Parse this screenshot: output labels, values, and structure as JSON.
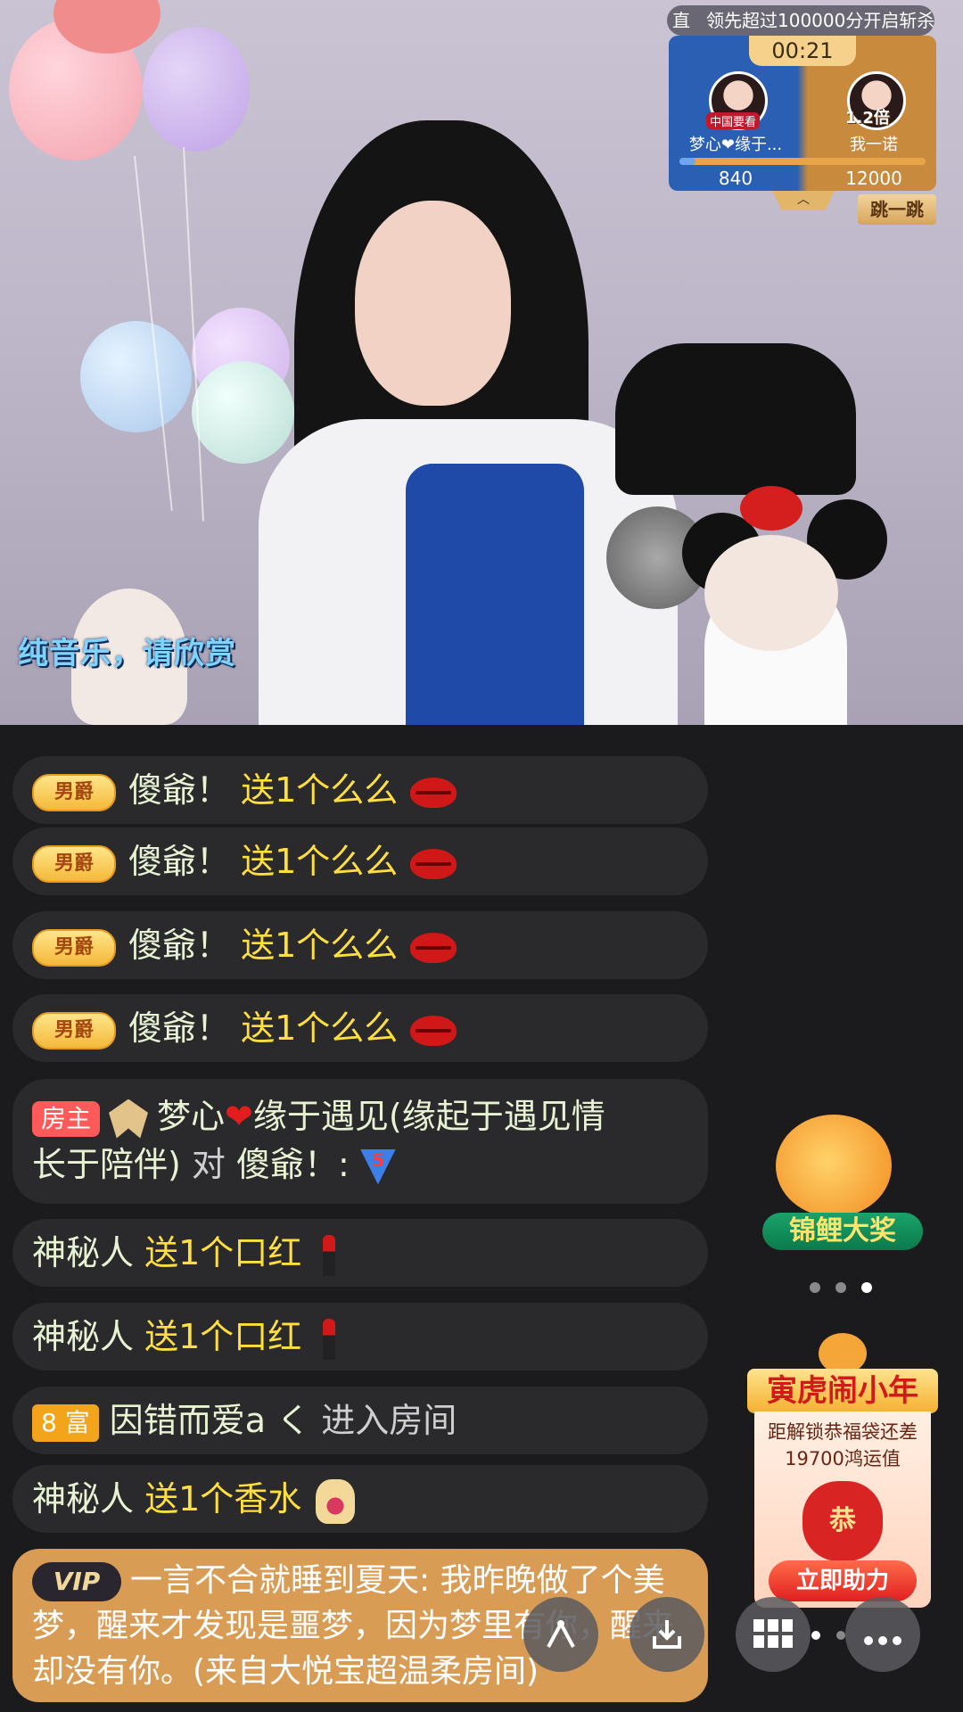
{
  "video": {
    "overlay_text": "纯音乐，请欣赏"
  },
  "pk": {
    "banner_prefix": "直",
    "banner_text": "领先超过100000分开启斩杀",
    "timer": "00:21",
    "left_avatar_tag": "中国要看",
    "right_avatar_tag": "1.2倍",
    "left_name": "梦心❤缘于...",
    "right_name": "我一诺",
    "left_score": "840",
    "right_score": "12000",
    "left_ratio": 0.065,
    "collapse_symbol": "︿",
    "jump_button": "跳一跳",
    "left_color": "#2a5fb3",
    "right_color": "#c88a3c"
  },
  "chat": {
    "nanjue_badge": "男爵",
    "messages": [
      {
        "name": "傻爺！",
        "gift": "送1个么么"
      },
      {
        "name": "傻爺！",
        "gift": "送1个么么"
      },
      {
        "name": "傻爺！",
        "gift": "送1个么么"
      },
      {
        "name": "傻爺！",
        "gift": "送1个么么"
      }
    ],
    "host_msg": {
      "badge": "房主",
      "name_a": "梦心",
      "heart": "❤",
      "name_b": "缘于遇见(缘起于遇见情",
      "line2_a": "长于陪伴)",
      "line2_b": "对",
      "line2_c": "傻爺！:",
      "level": "5"
    },
    "lipstick_msgs": [
      {
        "name": "神秘人",
        "gift": "送1个口红"
      },
      {
        "name": "神秘人",
        "gift": "送1个口红"
      }
    ],
    "enter_msg": {
      "rich_level": "8",
      "rich_label": "富",
      "name": "因错而爱a く",
      "action": "进入房间"
    },
    "perfume_msg": {
      "name": "神秘人",
      "gift": "送1个香水"
    },
    "vip_msg": {
      "badge": "VIP",
      "text": "一言不合就睡到夏天: 我昨晚做了个美梦，醒来才发现是噩梦，因为梦里有你，醒来却没有你。(来自大悦宝超温柔房间)"
    }
  },
  "promos": {
    "fish_label": "锦鲤大奖",
    "tiger_title": "寅虎闹小年",
    "tiger_desc_1": "距解锁恭福袋还差",
    "tiger_desc_2": "19700鸿运值",
    "tiger_bag_char": "恭",
    "tiger_button": "立即助力"
  },
  "bottom": {
    "share_icon": "share-icon",
    "download_icon": "download-icon",
    "grid_icon": "grid-icon",
    "more_icon": "more-icon"
  }
}
